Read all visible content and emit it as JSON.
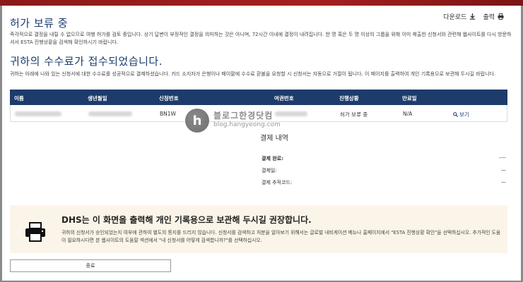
{
  "header": {
    "title": "허가 보류 중",
    "download_label": "다운로드",
    "print_label": "출력"
  },
  "notice1": "즉각적으로 결정을 내릴 수 없으므로 여행 허가를 검토 중입니다. 상기 답변이 부정적인 결정을 의미하는 것은 아니며, 72시간 이내에 결정이 내려집니다. 한 명 혹은 두 명 이상의 그룹을 위해 이미 제출한 신청서와 관련해 웹사이트를 다시 방문하셔서 ESTA 진행상황을 검색해 확인하시기 바랍니다.",
  "fee": {
    "title": "귀하의 수수료가 접수되었습니다.",
    "notice": "귀하는 아래에 나와 있는 신청서에 대한 수수료를 성공적으로 결제하셨습니다. 카드 소지자가 은행이나 페이팔에 수수료 환불을 요청할 시 신청서는 자동으로 거절이 됩니다. 이 페이지를 출력하여 개인 기록용으로 보관해 두시길 바랍니다."
  },
  "table": {
    "headers": {
      "name": "이름",
      "dob": "생년월일",
      "app_no": "신청번호",
      "passport": "여권번호",
      "status": "진행상황",
      "expiry": "만료일"
    },
    "row": {
      "app_no": "BN1W",
      "status": "허가 보류 중",
      "expiry": "N/A",
      "view": "보기"
    }
  },
  "watermark": {
    "title": "블로그한경닷컴",
    "sub": "blog.hangyeong.com"
  },
  "payment": {
    "title": "결제 내역",
    "rows": [
      {
        "label": "결제 완료:",
        "value": "----"
      },
      {
        "label": "결제일:",
        "value": "—"
      },
      {
        "label": "결제 추적코드:",
        "value": "—"
      }
    ]
  },
  "dhs": {
    "title": "DHS는 이 화면을 출력해 개인 기록용으로 보관해 두시길 권장합니다.",
    "text": "귀하의 신청서가 승인되었는지 여부에 관하여 별도의 통지를 드리지 않습니다. 신청서를 검색하고 처분을 알아보기 위해서는 글로벌 내비게이션 메뉴나 홈페이지에서 \"ESTA 진행상황 확인\"을 선택하십시오. 추가적인 도움이 필요하시다면 본 웹사이트의 도움말 섹션에서 \"내 신청서를 어떻게 검색합니까?\"를 선택하십시오."
  },
  "close_label": "종료",
  "colors": {
    "brand_navy": "#1d3c6b",
    "top_bar": "#a51f1f",
    "notice_bg": "#fbf4e8"
  }
}
